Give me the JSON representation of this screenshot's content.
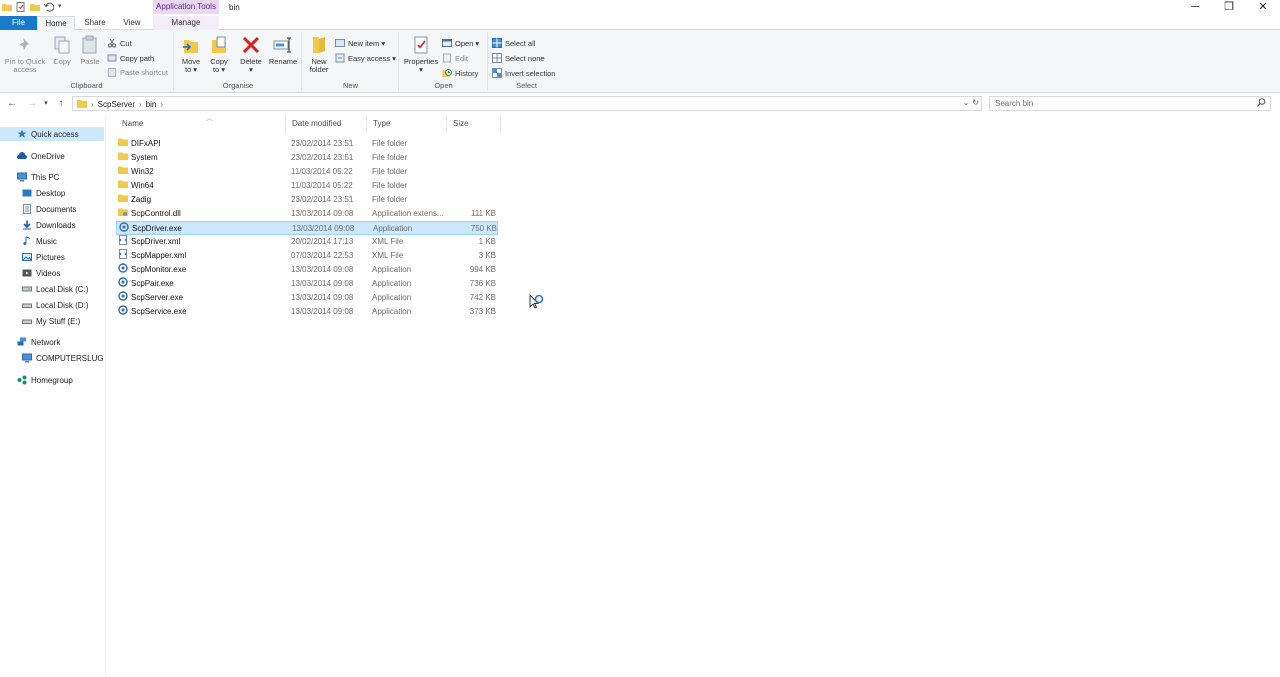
{
  "titlebar": {
    "context_tab": "Application Tools",
    "window_title": "bin",
    "controls": {
      "minimize": "─",
      "restore": "❐",
      "close": "✕"
    }
  },
  "tabs": {
    "file": "File",
    "home": "Home",
    "share": "Share",
    "view": "View",
    "manage": "Manage"
  },
  "ribbon": {
    "clipboard": {
      "label": "Clipboard",
      "pin_line1": "Pin to Quick",
      "pin_line2": "access",
      "copy": "Copy",
      "paste": "Paste",
      "cut": "Cut",
      "copy_path": "Copy path",
      "paste_shortcut": "Paste shortcut"
    },
    "organise": {
      "label": "Organise",
      "move_line1": "Move",
      "move_line2": "to ▾",
      "copy_line1": "Copy",
      "copy_line2": "to ▾",
      "delete_line1": "Delete",
      "delete_line2": "▾",
      "rename": "Rename"
    },
    "new": {
      "label": "New",
      "new_folder_line1": "New",
      "new_folder_line2": "folder",
      "new_item": "New item ▾",
      "easy_access": "Easy access ▾"
    },
    "open": {
      "label": "Open",
      "properties_line1": "Properties",
      "properties_line2": "▾",
      "open": "Open ▾",
      "edit": "Edit",
      "history": "History"
    },
    "select": {
      "label": "Select",
      "select_all": "Select all",
      "select_none": "Select none",
      "invert_selection": "Invert selection"
    }
  },
  "address": {
    "crumbs": [
      "ScpServer",
      "bin"
    ],
    "search_placeholder": "Search bin"
  },
  "nav": {
    "quick_access": "Quick access",
    "onedrive": "OneDrive",
    "this_pc": "This PC",
    "desktop": "Desktop",
    "documents": "Documents",
    "downloads": "Downloads",
    "music": "Music",
    "pictures": "Pictures",
    "videos": "Videos",
    "local_c": "Local Disk (C:)",
    "local_d": "Local Disk (D:)",
    "mystuff": "My Stuff (E:)",
    "network": "Network",
    "computer": "COMPUTERSLUGGI",
    "homegroup": "Homegroup"
  },
  "columns": {
    "name": "Name",
    "date": "Date modified",
    "type": "Type",
    "size": "Size"
  },
  "files": [
    {
      "name": "DIFxAPI",
      "date": "23/02/2014 23:51",
      "type": "File folder",
      "size": "",
      "icon": "folder-icon"
    },
    {
      "name": "System",
      "date": "23/02/2014 23:51",
      "type": "File folder",
      "size": "",
      "icon": "folder-icon"
    },
    {
      "name": "Win32",
      "date": "11/03/2014 05:22",
      "type": "File folder",
      "size": "",
      "icon": "folder-icon"
    },
    {
      "name": "Win64",
      "date": "11/03/2014 05:22",
      "type": "File folder",
      "size": "",
      "icon": "folder-icon"
    },
    {
      "name": "Zadig",
      "date": "23/02/2014 23:51",
      "type": "File folder",
      "size": "",
      "icon": "folder-icon"
    },
    {
      "name": "ScpControl.dll",
      "date": "13/03/2014 09:08",
      "type": "Application extens...",
      "size": "111 KB",
      "icon": "dll-icon"
    },
    {
      "name": "ScpDriver.exe",
      "date": "13/03/2014 09:08",
      "type": "Application",
      "size": "750 KB",
      "icon": "app-icon"
    },
    {
      "name": "ScpDriver.xml",
      "date": "20/02/2014 17:13",
      "type": "XML File",
      "size": "1 KB",
      "icon": "xml-icon"
    },
    {
      "name": "ScpMapper.xml",
      "date": "07/03/2014 22:53",
      "type": "XML File",
      "size": "3 KB",
      "icon": "xml-icon"
    },
    {
      "name": "ScpMonitor.exe",
      "date": "13/03/2014 09:08",
      "type": "Application",
      "size": "994 KB",
      "icon": "app-icon"
    },
    {
      "name": "ScpPair.exe",
      "date": "13/03/2014 09:08",
      "type": "Application",
      "size": "736 KB",
      "icon": "app-icon"
    },
    {
      "name": "ScpServer.exe",
      "date": "13/03/2014 09:08",
      "type": "Application",
      "size": "742 KB",
      "icon": "app-icon"
    },
    {
      "name": "ScpService.exe",
      "date": "13/03/2014 09:08",
      "type": "Application",
      "size": "373 KB",
      "icon": "app-icon"
    }
  ],
  "colors": {
    "accent": "#1979ca",
    "selection": "#cce8ff",
    "context_tab": "#e9d7f3",
    "folder": "#f2c94c"
  }
}
